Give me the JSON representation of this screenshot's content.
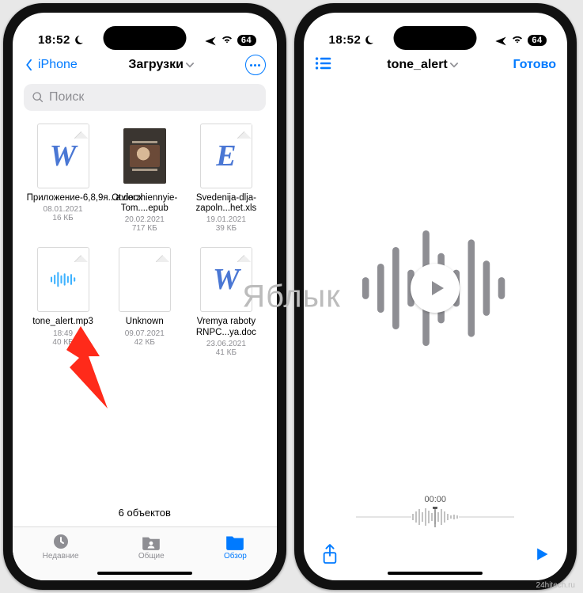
{
  "status": {
    "time": "18:52",
    "battery": "64"
  },
  "left": {
    "back_label": "iPhone",
    "title": "Загрузки",
    "search_placeholder": "Поиск",
    "files": [
      {
        "name": "Приложение-6,8,9я...a.docx",
        "date": "08.01.2021",
        "size": "16 КБ",
        "thumb": "W"
      },
      {
        "name": "Otvierzhiennyie-Tom....epub",
        "date": "20.02.2021",
        "size": "717 КБ",
        "thumb": "img"
      },
      {
        "name": "Svedenija-dlja-zapoln...het.xls",
        "date": "19.01.2021",
        "size": "39 КБ",
        "thumb": "E"
      },
      {
        "name": "tone_alert.mp3",
        "date": "18:49",
        "size": "40 КБ",
        "thumb": "wave"
      },
      {
        "name": "Unknown",
        "date": "09.07.2021",
        "size": "42 КБ",
        "thumb": "blank"
      },
      {
        "name": "Vremya raboty RNPC...ya.doc",
        "date": "23.06.2021",
        "size": "41 КБ",
        "thumb": "W"
      }
    ],
    "summary": "6 объектов",
    "tabs": {
      "recents": "Недавние",
      "shared": "Общие",
      "browse": "Обзор"
    }
  },
  "right": {
    "title": "tone_alert",
    "done": "Готово",
    "time_label": "00:00"
  },
  "watermark": "Яблык",
  "credit": "24hitech.ru"
}
